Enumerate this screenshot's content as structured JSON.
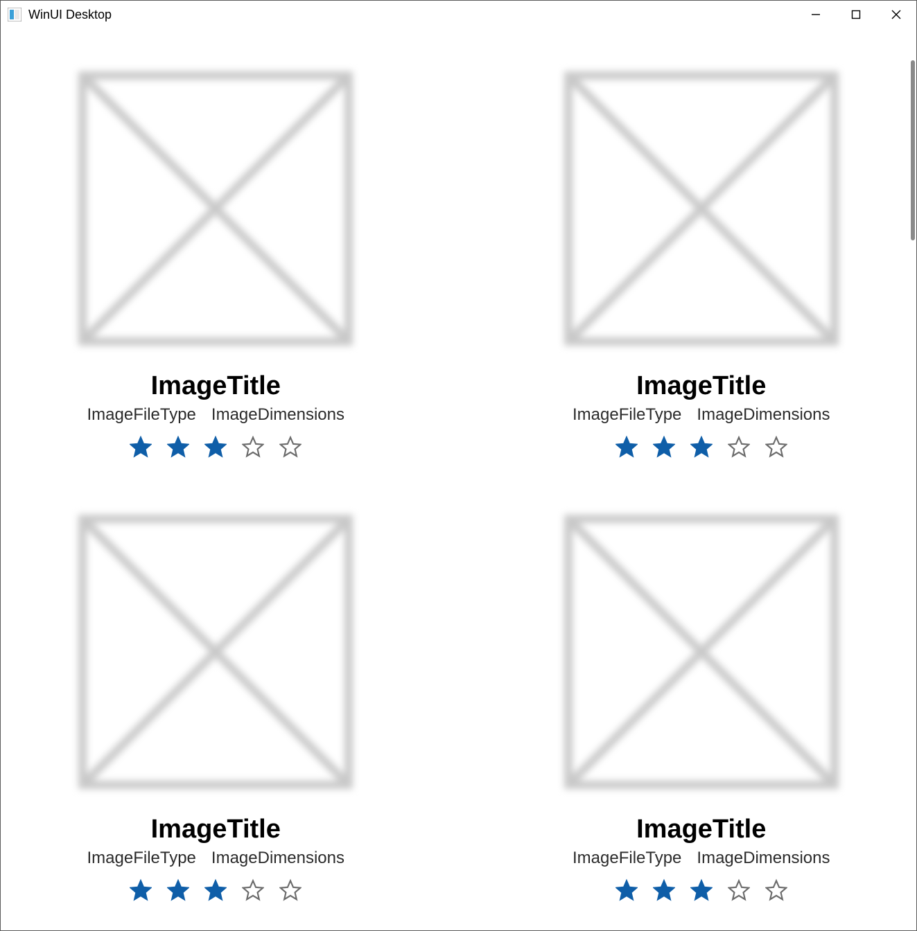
{
  "window": {
    "title": "WinUI Desktop"
  },
  "colors": {
    "starFilled": "#0f5ea8",
    "starEmpty": "#6b6b6b",
    "placeholder": "#c9c9c9"
  },
  "items": [
    {
      "title": "ImageTitle",
      "fileType": "ImageFileType",
      "dimensions": "ImageDimensions",
      "rating": 3,
      "maxRating": 5
    },
    {
      "title": "ImageTitle",
      "fileType": "ImageFileType",
      "dimensions": "ImageDimensions",
      "rating": 3,
      "maxRating": 5
    },
    {
      "title": "ImageTitle",
      "fileType": "ImageFileType",
      "dimensions": "ImageDimensions",
      "rating": 3,
      "maxRating": 5
    },
    {
      "title": "ImageTitle",
      "fileType": "ImageFileType",
      "dimensions": "ImageDimensions",
      "rating": 3,
      "maxRating": 5
    }
  ]
}
